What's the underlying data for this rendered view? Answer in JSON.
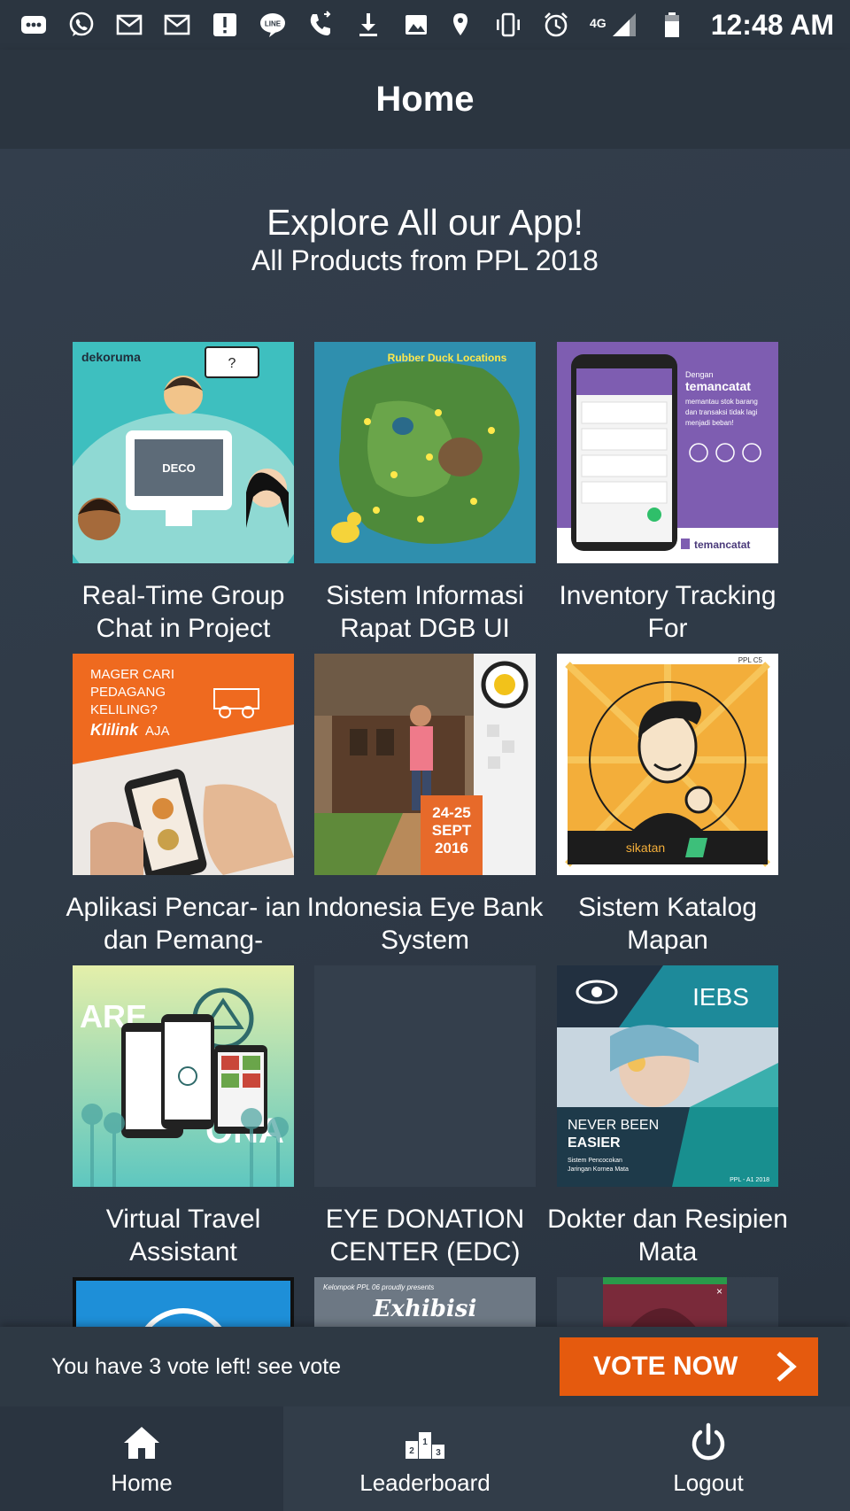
{
  "status_bar": {
    "network": "4G",
    "time": "12:48 AM",
    "icons": [
      "messages-icon",
      "whatsapp-icon",
      "gmail-icon",
      "gmail-icon",
      "alert-icon",
      "line-icon",
      "call-icon",
      "download-icon",
      "image-icon",
      "location-icon",
      "vibrate-icon",
      "alarm-icon",
      "signal-icon",
      "battery-icon"
    ]
  },
  "app_bar": {
    "title": "Home"
  },
  "hero": {
    "title": "Explore All our App!",
    "subtitle": "All Products from PPL 2018"
  },
  "products": [
    {
      "title": "Real-Time Group Chat in Project",
      "thumb_text": "dekoruma",
      "thumb_subtext": "DECO"
    },
    {
      "title": "Sistem Informasi Rapat DGB UI",
      "thumb_text": "Rubber Duck Locations"
    },
    {
      "title": "Inventory Tracking For",
      "thumb_text": "temancatat",
      "thumb_subtext": "Dengan temancatat memantau stok barang dan transaksi tidak lagi menjadi beban!"
    },
    {
      "title": "Aplikasi Pencar- ian dan Pemang-",
      "thumb_text": "MAGER CARI PEDAGANG KELILING?",
      "thumb_subtext": "Klilink AJA"
    },
    {
      "title": "Indonesia Eye Bank System",
      "thumb_text": "24-25 SEPT 2016"
    },
    {
      "title": "Sistem Katalog Mapan",
      "thumb_text": "sikatan",
      "thumb_subtext": "PPL C5"
    },
    {
      "title": "Virtual Travel Assistant",
      "thumb_text": "ARE ONA"
    },
    {
      "title": "EYE DONATION CENTER (EDC)",
      "thumb_text": ""
    },
    {
      "title": "Dokter dan Resipien Mata",
      "thumb_text": "IEBS",
      "thumb_subtext": "NEVER BEEN EASIER"
    },
    {
      "title": "",
      "thumb_text": ""
    },
    {
      "title": "",
      "thumb_text": "Exhibisi"
    },
    {
      "title": "",
      "thumb_text": ""
    }
  ],
  "vote_bar": {
    "text": "You have 3 vote left! see vote",
    "button_label": "VOTE NOW"
  },
  "bottom_nav": {
    "items": [
      {
        "label": "Home",
        "icon": "home-icon",
        "active": true
      },
      {
        "label": "Leaderboard",
        "icon": "podium-icon",
        "active": false
      },
      {
        "label": "Logout",
        "icon": "power-icon",
        "active": false
      }
    ]
  },
  "colors": {
    "background": "#2f3a47",
    "bar": "#2b3540",
    "accent": "#e55a0e"
  }
}
